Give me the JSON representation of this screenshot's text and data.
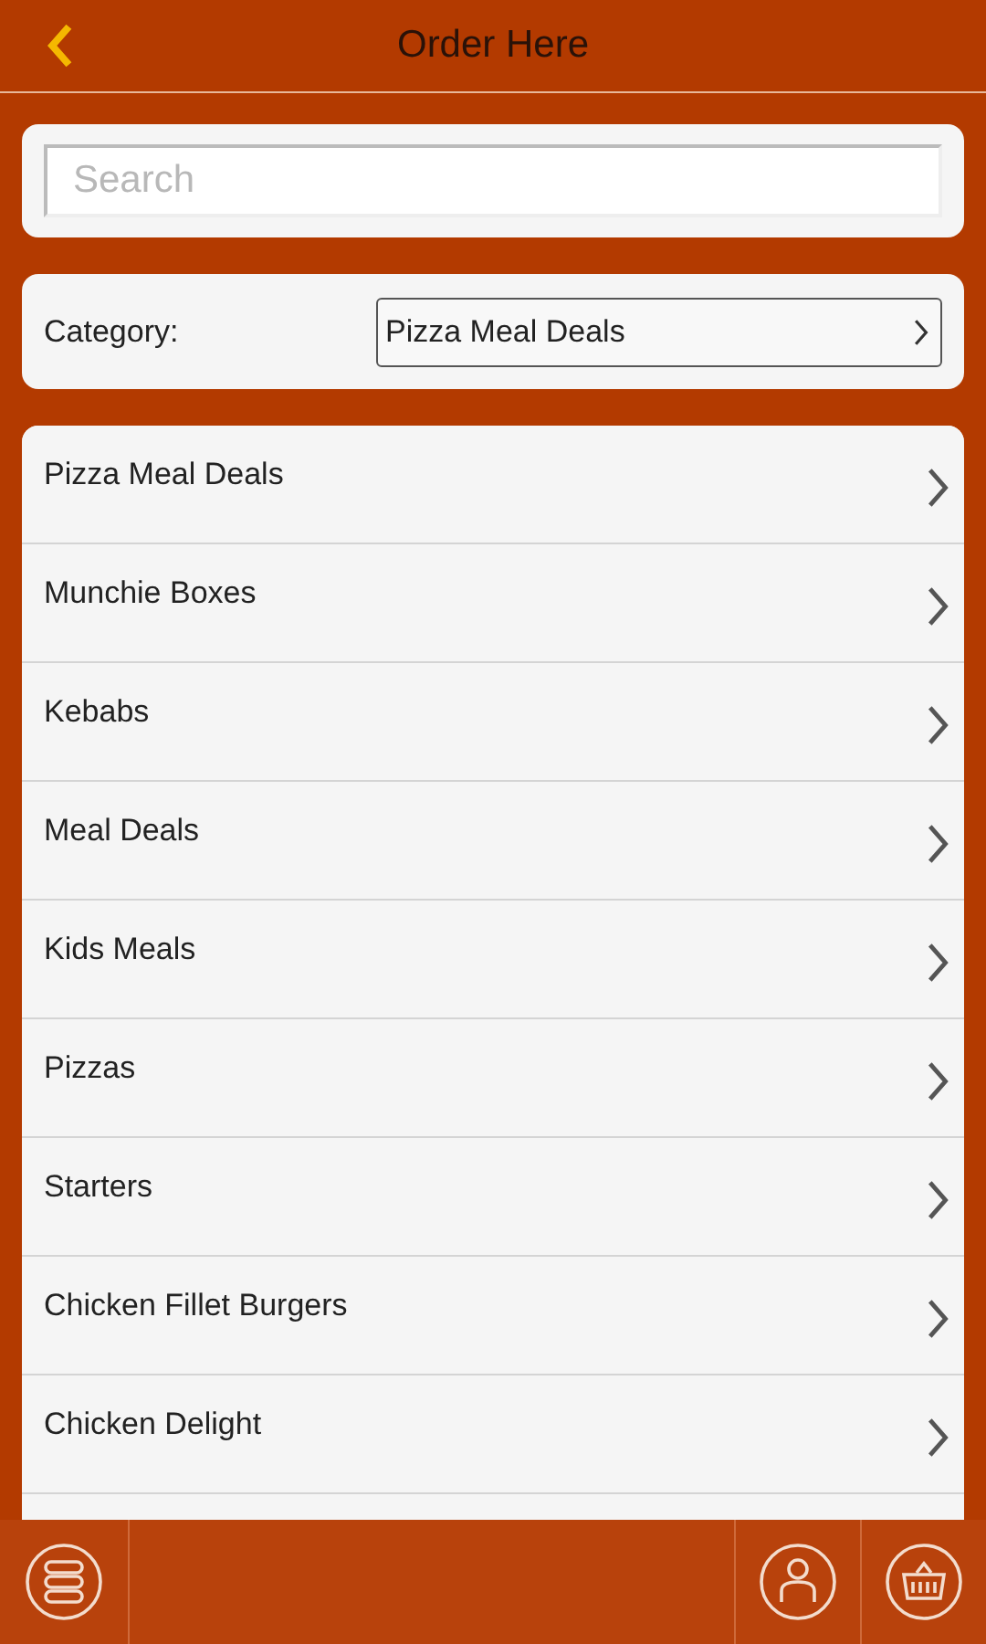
{
  "header": {
    "title": "Order Here"
  },
  "search": {
    "placeholder": "Search"
  },
  "category": {
    "label": "Category:",
    "value": "Pizza Meal Deals"
  },
  "items": [
    {
      "label": "Pizza Meal Deals"
    },
    {
      "label": "Munchie Boxes"
    },
    {
      "label": "Kebabs"
    },
    {
      "label": "Meal Deals"
    },
    {
      "label": "Kids Meals"
    },
    {
      "label": "Pizzas"
    },
    {
      "label": "Starters"
    },
    {
      "label": "Chicken Fillet Burgers"
    },
    {
      "label": "Chicken Delight"
    }
  ],
  "bottom_bar": [
    {
      "kind": "menu"
    },
    {
      "kind": "account"
    },
    {
      "kind": "basket"
    }
  ]
}
